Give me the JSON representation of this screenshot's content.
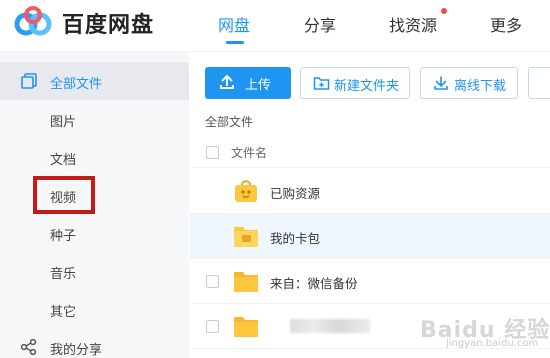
{
  "app": {
    "brand": "百度网盘"
  },
  "nav": [
    {
      "label": "网盘",
      "active": true
    },
    {
      "label": "分享",
      "active": false
    },
    {
      "label": "找资源",
      "active": false,
      "notification_dot": true
    },
    {
      "label": "更多",
      "active": false
    }
  ],
  "sidebar": {
    "items": [
      {
        "label": "全部文件",
        "icon": "files-icon",
        "active": true
      },
      {
        "label": "图片"
      },
      {
        "label": "文档"
      },
      {
        "label": "视频",
        "highlighted": true
      },
      {
        "label": "种子"
      },
      {
        "label": "音乐"
      },
      {
        "label": "其它"
      },
      {
        "label": "我的分享",
        "icon": "share-icon"
      }
    ]
  },
  "toolbar": {
    "upload_label": "上传",
    "new_folder_label": "新建文件夹",
    "offline_download_label": "离线下载"
  },
  "breadcrumb": "全部文件",
  "file_list": {
    "header": "文件名",
    "rows": [
      {
        "name": "已购资源",
        "icon": "bag-icon",
        "has_checkbox": false
      },
      {
        "name": "我的卡包",
        "icon": "card-folder-icon",
        "has_checkbox": false,
        "selected": true
      },
      {
        "name": "来自：微信备份",
        "icon": "folder-icon",
        "has_checkbox": true
      },
      {
        "name": "",
        "icon": "folder-icon",
        "has_checkbox": true,
        "obscured": true
      }
    ]
  },
  "watermark": {
    "main": "Baidu 经验",
    "sub": "jingyan.baidu.com"
  },
  "colors": {
    "accent": "#1e95f0",
    "highlight": "#c41919",
    "folder": "#fcc73f",
    "dot": "#f04a3e"
  }
}
